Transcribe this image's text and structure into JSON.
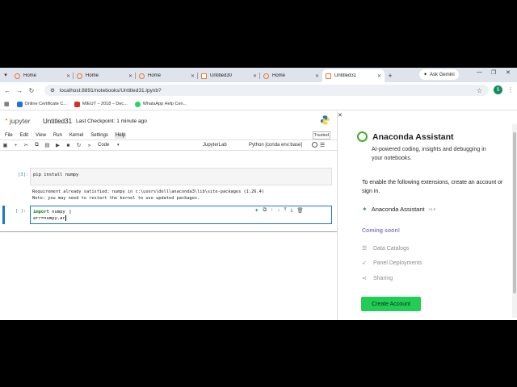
{
  "browser": {
    "tabs": [
      {
        "title": "Home",
        "active": false
      },
      {
        "title": "Home",
        "active": false
      },
      {
        "title": "Home",
        "active": false
      },
      {
        "title": "Untitled30",
        "active": false
      },
      {
        "title": "Home",
        "active": false
      },
      {
        "title": "Untitled31",
        "active": true
      }
    ],
    "ask_gemini": "Ask Gemini",
    "url": "localhost:8891/notebooks/Untitled31.ipynb?",
    "profile_initial": "S",
    "bookmarks": [
      {
        "label": "Online Certificate C...",
        "color": "#1a73e8"
      },
      {
        "label": "MIEUT – 2018 – Dec...",
        "color": "#d93025"
      },
      {
        "label": "WhatsApp Help Cen...",
        "color": "#25d366"
      }
    ]
  },
  "jupyter": {
    "logo_text": "jupyter",
    "notebook_title": "Untitled31",
    "checkpoint": "Last Checkpoint: 1 minute ago",
    "menu": [
      "File",
      "Edit",
      "View",
      "Run",
      "Kernel",
      "Settings",
      "Help"
    ],
    "active_menu": "Help",
    "trusted": "Trusted",
    "cell_type": "Code",
    "jupyterlab_link": "JupyterLab",
    "kernel": "Python [conda env:base]",
    "cells": [
      {
        "prompt": "[3]:",
        "source": "pip install numpy",
        "output": "Requirement already satisfied: numpy in c:\\users\\dell\\anaconda3\\lib\\site-packages (1.26.4)\nNote: you may need to restart the kernel to use updated packages."
      },
      {
        "prompt": "[ ]:",
        "line1_kw": "import",
        "line1_rest": " numpy",
        "line2": "arr=numpy.ar"
      }
    ]
  },
  "assistant": {
    "title": "Anaconda Assistant",
    "subtitle": "AI-powered coding, insights and debugging in your notebooks.",
    "enable_text": "To enable the following extensions, create an account or sign in.",
    "extension_name": "Anaconda Assistant",
    "extension_version": "v1.6",
    "coming_soon": "Coming soon!",
    "features": [
      "Data Catalogs",
      "Panel Deployments",
      "Sharing"
    ],
    "create_account": "Create Account"
  }
}
